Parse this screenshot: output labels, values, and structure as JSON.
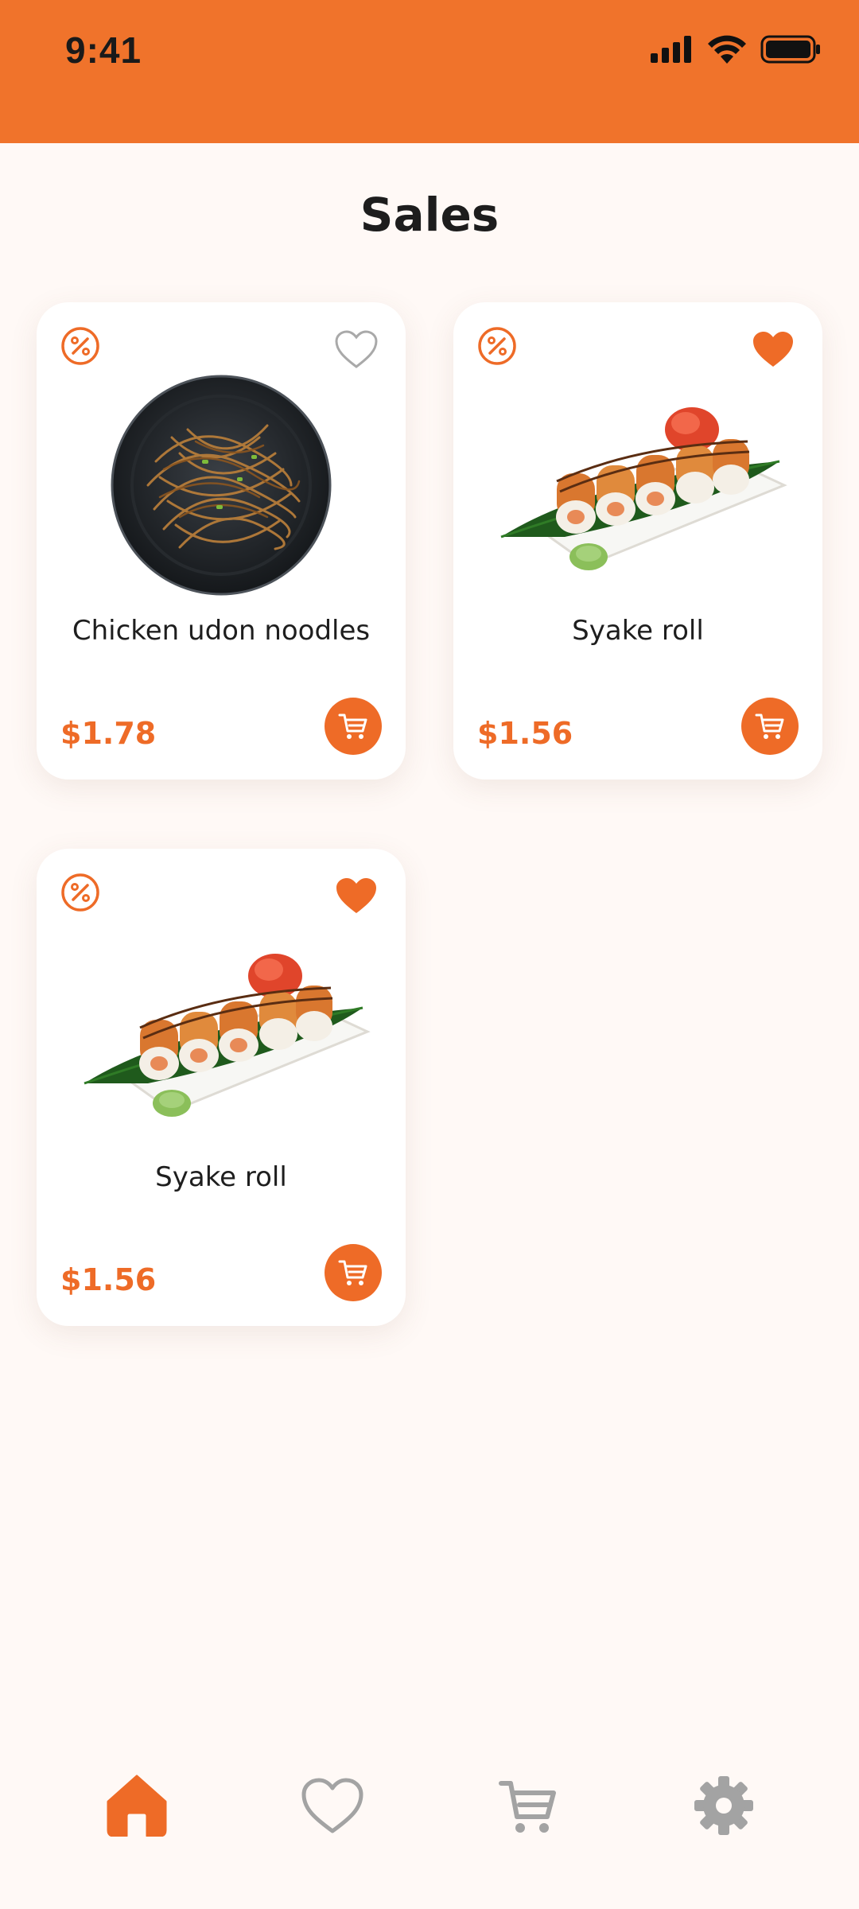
{
  "status_bar": {
    "time": "9:41",
    "background": "#F0732B"
  },
  "page_title": "Sales",
  "accent_color": "#EE6B27",
  "products": [
    {
      "name": "Chicken udon noodles",
      "price": "$1.78",
      "favorite": false,
      "image": "udon-noodles-bowl",
      "badge_icon": "discount-icon"
    },
    {
      "name": "Syake roll",
      "price": "$1.56",
      "favorite": true,
      "image": "syake-roll-plate",
      "badge_icon": "discount-icon"
    },
    {
      "name": "Syake roll",
      "price": "$1.56",
      "favorite": true,
      "image": "syake-roll-plate",
      "badge_icon": "discount-icon"
    }
  ],
  "bottom_nav": [
    {
      "name": "home",
      "icon": "home-icon",
      "active": true
    },
    {
      "name": "favorites",
      "icon": "heart-icon",
      "active": false
    },
    {
      "name": "cart",
      "icon": "cart-icon",
      "active": false
    },
    {
      "name": "settings",
      "icon": "gear-icon",
      "active": false
    }
  ]
}
